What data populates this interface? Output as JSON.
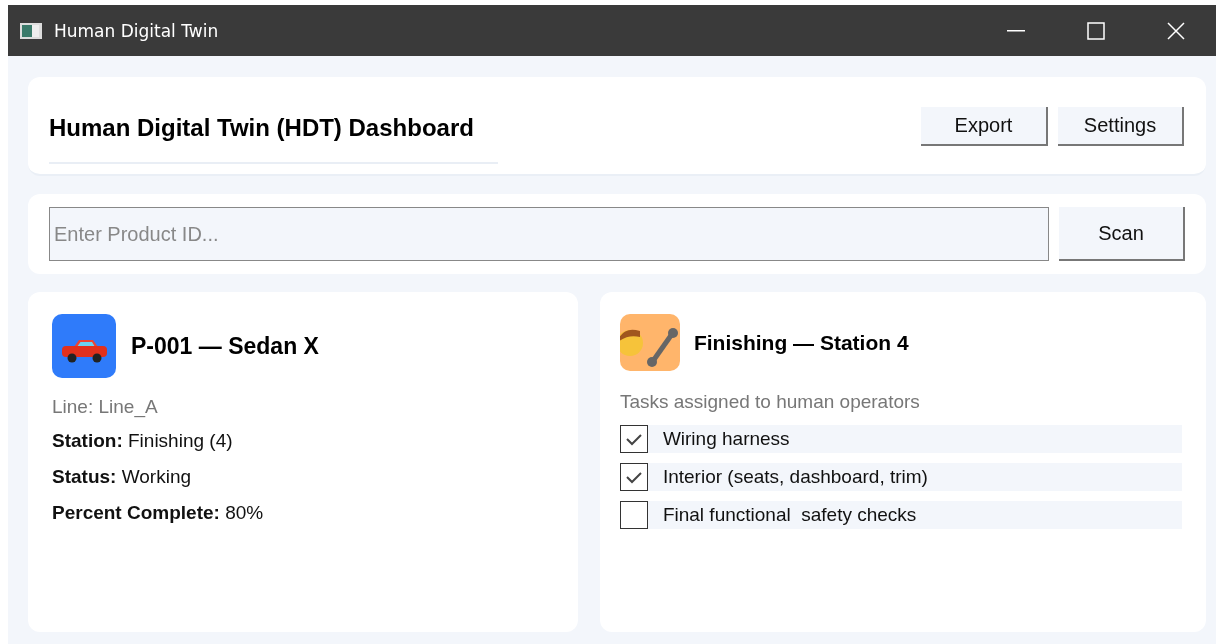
{
  "window": {
    "title": "Human Digital Twin"
  },
  "header": {
    "title": "Human Digital Twin (HDT) Dashboard",
    "buttons": [
      "Export",
      "Settings"
    ]
  },
  "search": {
    "placeholder": "Enter Product ID...",
    "button": "Scan"
  },
  "product": {
    "title": "P-001 — Sedan X",
    "line": "Line: Line_A",
    "fields": [
      {
        "label": "Station:",
        "value": "Finishing (4)"
      },
      {
        "label": "Status:",
        "value": "Working"
      },
      {
        "label": "Percent Complete:",
        "value": "80%"
      }
    ]
  },
  "station": {
    "title": "Finishing — Station 4",
    "subtitle": "Tasks assigned to human operators",
    "tasks": [
      {
        "label": "Wiring harness",
        "checked": true
      },
      {
        "label": "Interior (seats, dashboard, trim)",
        "checked": true
      },
      {
        "label": "Final functional  safety checks",
        "checked": false
      }
    ]
  }
}
